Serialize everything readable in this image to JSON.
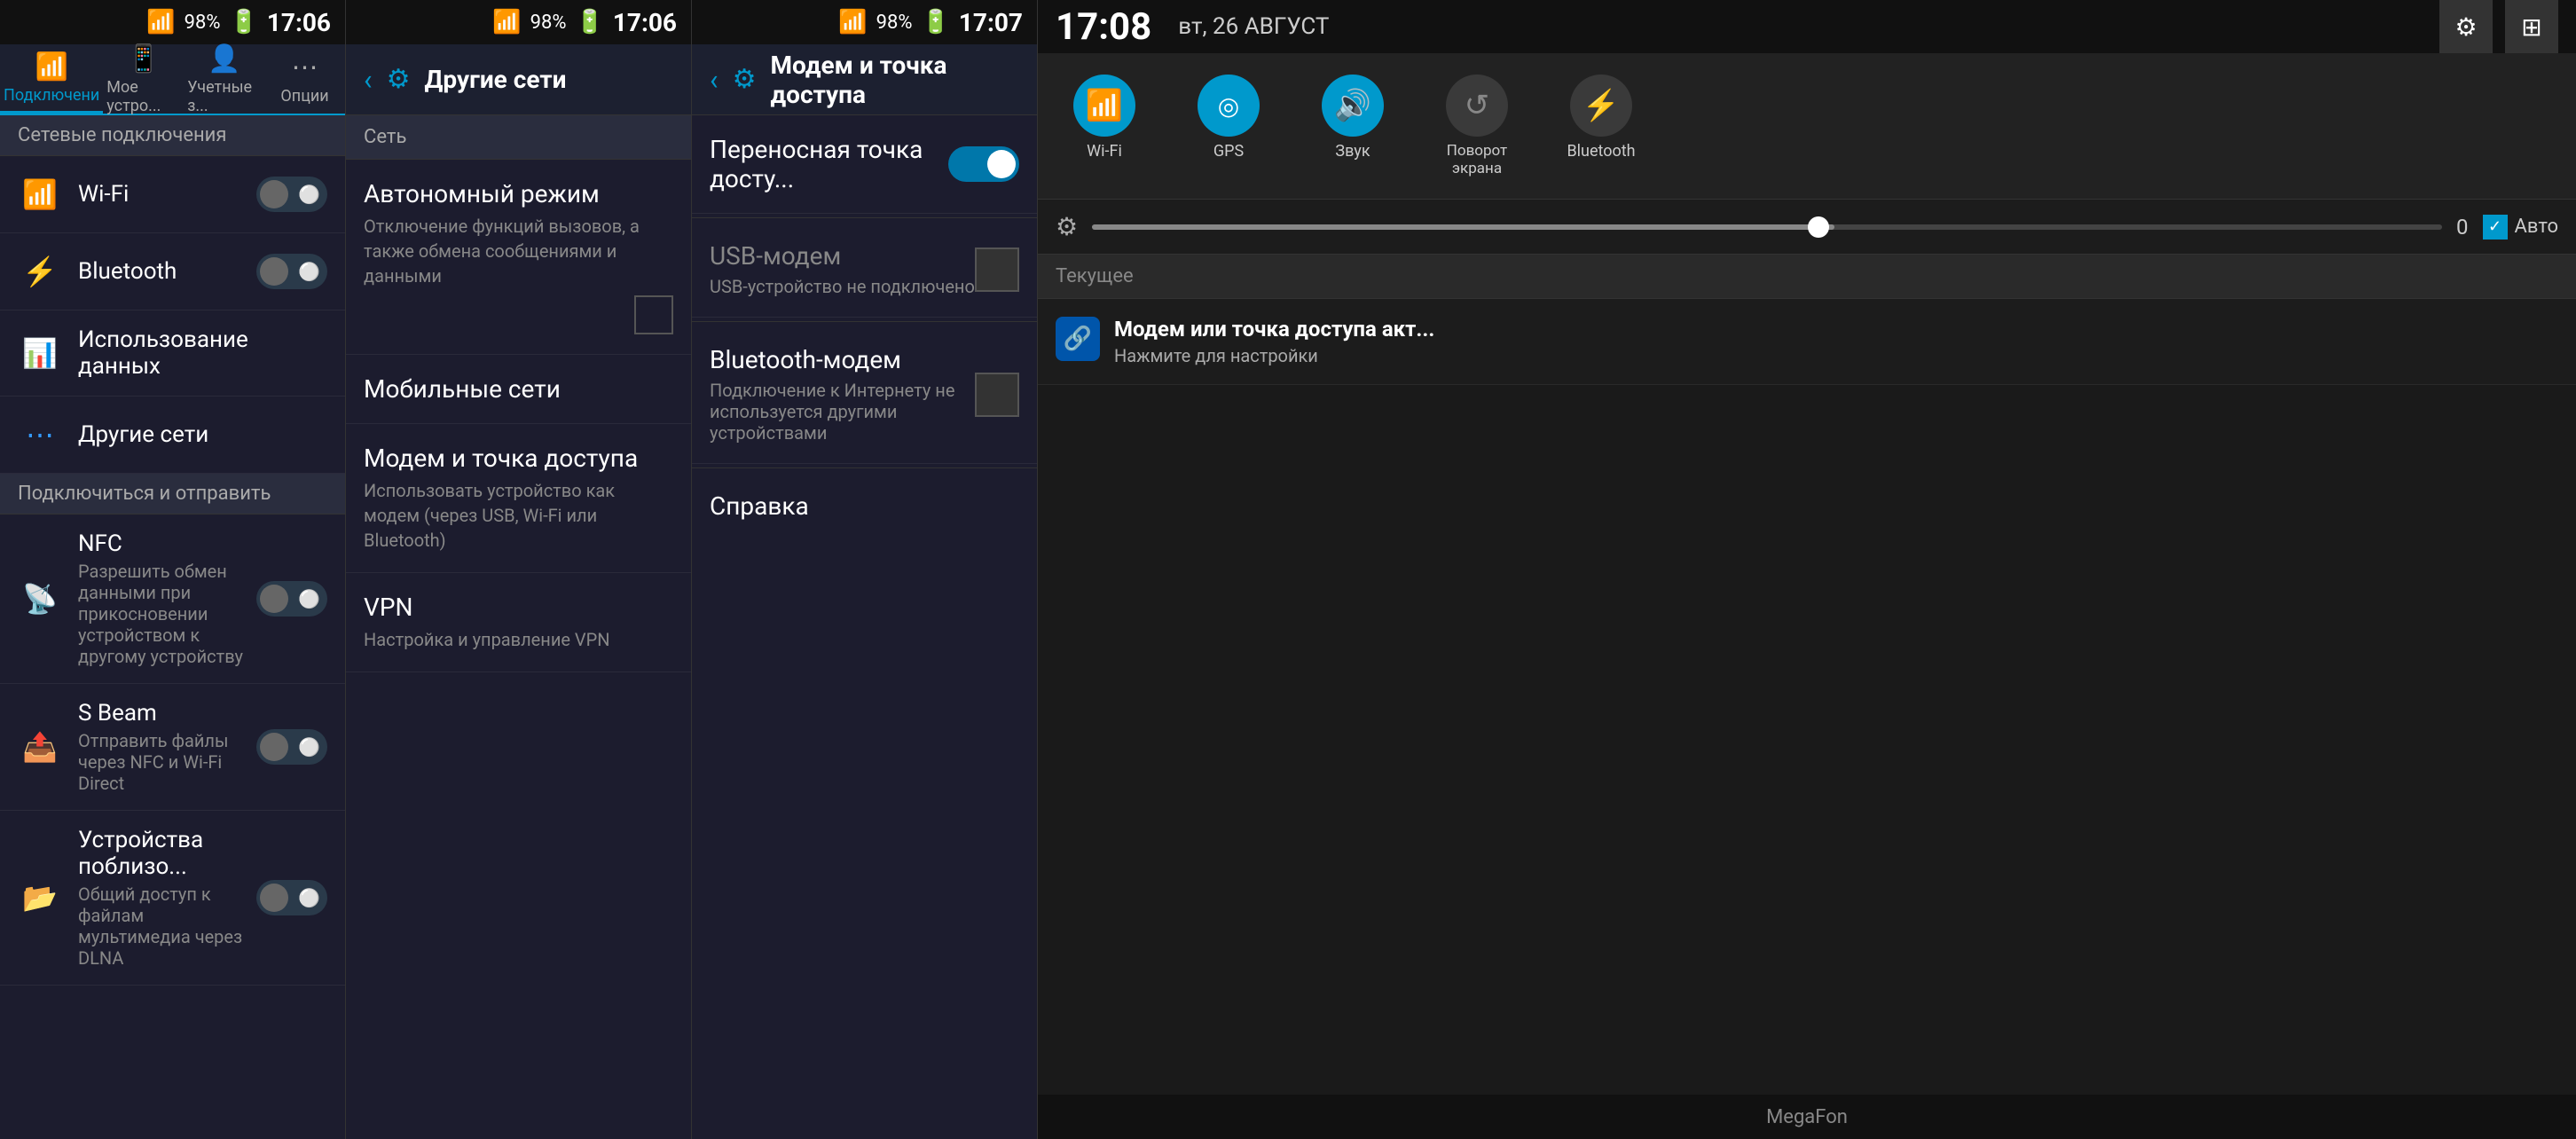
{
  "panel1": {
    "statusBar": {
      "signal": "98%",
      "time": "17:06"
    },
    "tabs": [
      {
        "id": "connections",
        "label": "Подключени",
        "icon": "📶",
        "active": true
      },
      {
        "id": "mydevice",
        "label": "Мое устро...",
        "icon": "📱",
        "active": false
      },
      {
        "id": "accounts",
        "label": "Учетные з...",
        "icon": "👤",
        "active": false
      },
      {
        "id": "options",
        "label": "Опции",
        "icon": "⋯",
        "active": false
      }
    ],
    "sectionHeader": "Сетевые подключения",
    "items": [
      {
        "id": "wifi",
        "icon": "wifi",
        "title": "Wi-Fi",
        "toggleOff": true
      },
      {
        "id": "bluetooth",
        "icon": "bluetooth",
        "title": "Bluetooth",
        "toggleOff": true
      },
      {
        "id": "data-usage",
        "icon": "data",
        "title": "Использование данных",
        "toggleOff": false
      },
      {
        "id": "other-networks",
        "icon": "other",
        "title": "Другие сети",
        "toggleOff": false
      }
    ],
    "sectionHeader2": "Подключиться и отправить",
    "items2": [
      {
        "id": "nfc",
        "icon": "nfc",
        "title": "NFC",
        "subtitle": "Разрешить обмен данными при прикосновении устройством к другому устройству",
        "toggleOff": true
      },
      {
        "id": "sbeam",
        "icon": "sbeam",
        "title": "S Beam",
        "subtitle": "Отправить файлы через NFC и Wi-Fi Direct",
        "toggleOff": true
      },
      {
        "id": "nearby",
        "icon": "nearby",
        "title": "Устройства поблизо...",
        "subtitle": "Общий доступ к файлам мультимедиа через DLNA",
        "toggleOff": true
      }
    ]
  },
  "panel2": {
    "statusBar": {
      "signal": "98%",
      "time": "17:06"
    },
    "header": {
      "title": "Другие сети",
      "backLabel": "‹",
      "settingsIcon": "⚙"
    },
    "sectionHeader": "Сеть",
    "items": [
      {
        "id": "offline",
        "title": "Автономный режим",
        "subtitle": "Отключение функций вызовов, а также обмена сообщениями и данными"
      },
      {
        "id": "mobile",
        "title": "Мобильные сети",
        "subtitle": ""
      },
      {
        "id": "tethering",
        "title": "Модем и точка доступа",
        "subtitle": "Использовать устройство как модем (через USB, Wi-Fi или Bluetooth)"
      },
      {
        "id": "vpn",
        "title": "VPN",
        "subtitle": "Настройка и управление VPN"
      }
    ]
  },
  "panel3": {
    "statusBar": {
      "signal": "98%",
      "time": "17:07"
    },
    "header": {
      "title": "Модем и точка доступа",
      "backLabel": "‹",
      "settingsIcon": "⚙"
    },
    "items": [
      {
        "id": "portable-hotspot",
        "title": "Переносная точка досту...",
        "subtitle": "",
        "hasToggle": true,
        "toggleOn": true
      },
      {
        "id": "usb-modem",
        "title": "USB-модем",
        "subtitle": "USB-устройство не подключено",
        "hasCheckbox": true,
        "enabled": false
      },
      {
        "id": "bluetooth-modem",
        "title": "Bluetooth-модем",
        "subtitle": "Подключение к Интернету не используется другими устройствами",
        "hasCheckbox": true,
        "enabled": false
      }
    ],
    "helpItem": "Справка"
  },
  "panel4": {
    "statusBar": {
      "time": "17:08",
      "date": "вт, 26 АВГУСТ"
    },
    "quickToggles": [
      {
        "id": "wifi",
        "label": "Wi-Fi",
        "icon": "📶",
        "active": true
      },
      {
        "id": "gps",
        "label": "GPS",
        "icon": "◎",
        "active": true
      },
      {
        "id": "sound",
        "label": "Звук",
        "icon": "🔊",
        "active": true
      },
      {
        "id": "rotate",
        "label": "Поворот\nэкрана",
        "icon": "↺",
        "active": false
      },
      {
        "id": "bluetooth",
        "label": "Bluetooth",
        "icon": "⚡",
        "active": false
      }
    ],
    "brightness": {
      "value": "0",
      "autoLabel": "Авто"
    },
    "currentSection": "Текущее",
    "notifications": [
      {
        "id": "tethering-notif",
        "icon": "🔗",
        "title": "Модем или точка доступа акт...",
        "body": "Нажмите для настройки"
      }
    ],
    "providerLabel": "MegaFon",
    "settingsIcon": "⚙",
    "gridIcon": "⊞"
  }
}
